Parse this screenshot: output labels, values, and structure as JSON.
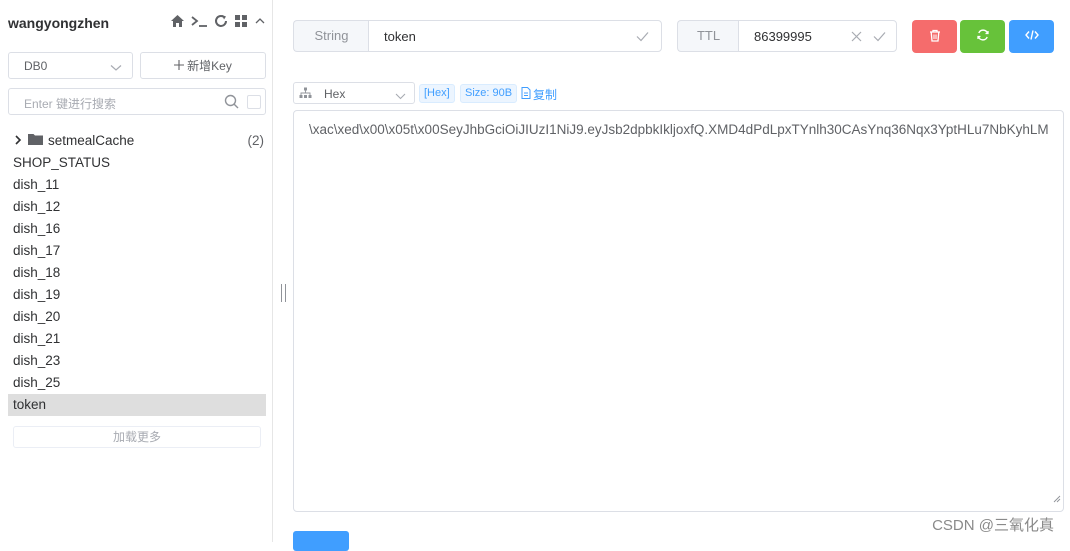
{
  "sidebar": {
    "connection_name": "wangyongzhen",
    "db": "DB0",
    "add_key_label": "新增Key",
    "search_placeholder": "Enter 键进行搜索",
    "folder": {
      "name": "setmealCache",
      "count": "(2)"
    },
    "keys": [
      "SHOP_STATUS",
      "dish_11",
      "dish_12",
      "dish_16",
      "dish_17",
      "dish_18",
      "dish_19",
      "dish_20",
      "dish_21",
      "dish_23",
      "dish_25",
      "token"
    ],
    "selected_key": "token",
    "load_more": "加载更多"
  },
  "main": {
    "type": "String",
    "key_name": "token",
    "ttl_label": "TTL",
    "ttl_value": "86399995",
    "viewer": "Hex",
    "format_tag": "[Hex]",
    "size_tag": "Size: 90B",
    "copy_label": "复制",
    "value": "\\xac\\xed\\x00\\x05t\\x00SeyJhbGciOiJIUzI1NiJ9.eyJsb2dpbkIkljoxfQ.XMD4dPdLpxTYnlh30CAsYnq36Nqx3YptHLu7NbKyhLM"
  },
  "watermark": "CSDN @三氧化真",
  "colors": {
    "danger": "#f56c6c",
    "success": "#67c23a",
    "primary": "#409eff"
  }
}
